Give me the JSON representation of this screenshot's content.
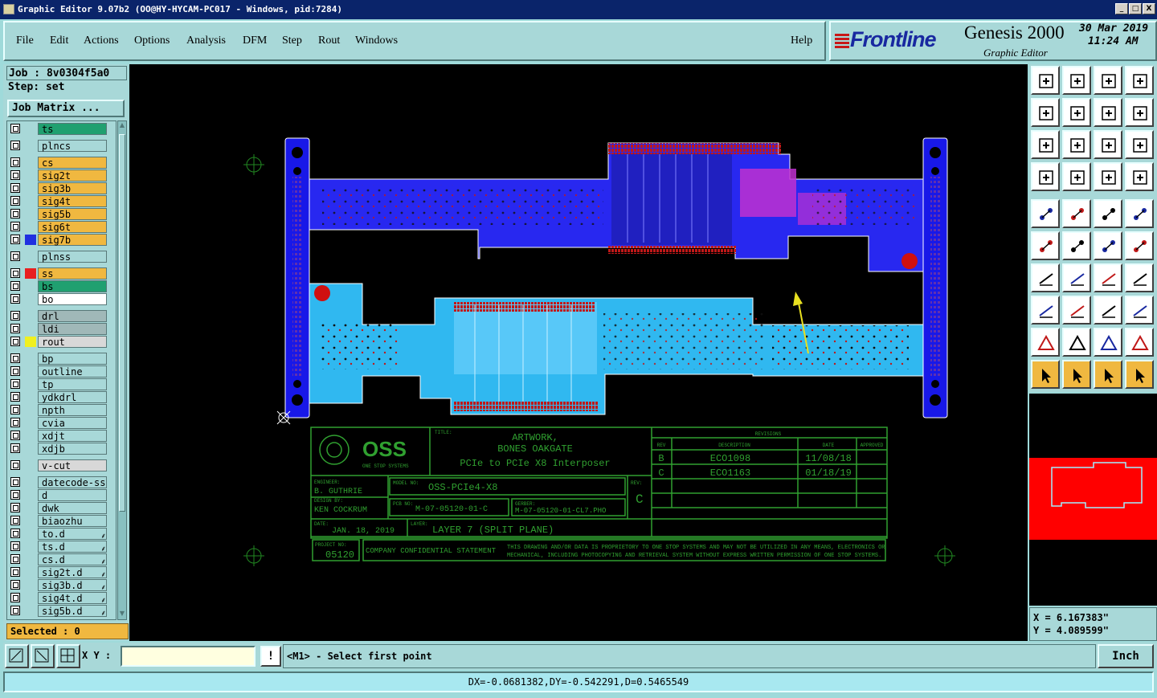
{
  "window": {
    "title": "Graphic Editor 9.07b2 (OO@HY-HYCAM-PC017 - Windows, pid:7284)",
    "min": "_",
    "max": "□",
    "close": "X"
  },
  "menu": [
    "File",
    "Edit",
    "Actions",
    "Options",
    "Analysis",
    "DFM",
    "Step",
    "Rout",
    "Windows"
  ],
  "help": "Help",
  "brand": {
    "logo": "Frontline",
    "product": "Genesis 2000",
    "subtitle": "Graphic Editor",
    "date": "30 Mar 2019",
    "time": "11:24 AM"
  },
  "job": {
    "job_label": "Job : 8v0304f5a0",
    "step_label": "Step: set",
    "matrix_button": "Job Matrix ..."
  },
  "layers": [
    {
      "name": "ts",
      "color": "#20a070",
      "swatch": "",
      "sep": false,
      "locked": false
    },
    {
      "name": "plncs",
      "color": "#a8d8d8",
      "swatch": "",
      "sep": true,
      "locked": false
    },
    {
      "name": "cs",
      "color": "#f0b840",
      "swatch": "",
      "sep": true,
      "locked": false
    },
    {
      "name": "sig2t",
      "color": "#f0b840",
      "swatch": "",
      "sep": false,
      "locked": false
    },
    {
      "name": "sig3b",
      "color": "#f0b840",
      "swatch": "",
      "sep": false,
      "locked": false
    },
    {
      "name": "sig4t",
      "color": "#f0b840",
      "swatch": "",
      "sep": false,
      "locked": false
    },
    {
      "name": "sig5b",
      "color": "#f0b840",
      "swatch": "",
      "sep": false,
      "locked": false
    },
    {
      "name": "sig6t",
      "color": "#f0b840",
      "swatch": "",
      "sep": false,
      "locked": false
    },
    {
      "name": "sig7b",
      "color": "#f0b840",
      "swatch": "#2030e0",
      "sep": false,
      "locked": false
    },
    {
      "name": "plnss",
      "color": "#a8d8d8",
      "swatch": "",
      "sep": true,
      "locked": false
    },
    {
      "name": "ss",
      "color": "#f0b840",
      "swatch": "#e82020",
      "sep": true,
      "locked": false
    },
    {
      "name": "bs",
      "color": "#20a070",
      "swatch": "",
      "sep": false,
      "locked": false
    },
    {
      "name": "bo",
      "color": "#ffffff",
      "swatch": "",
      "sep": false,
      "locked": false
    },
    {
      "name": "drl",
      "color": "#a0b8b8",
      "swatch": "",
      "sep": true,
      "locked": false
    },
    {
      "name": "ldi",
      "color": "#a0b8b8",
      "swatch": "",
      "sep": false,
      "locked": false
    },
    {
      "name": "rout",
      "color": "#d8d8d8",
      "swatch": "#f0f020",
      "sep": false,
      "locked": false
    },
    {
      "name": "bp",
      "color": "#a8d8d8",
      "swatch": "",
      "sep": true,
      "locked": false
    },
    {
      "name": "outline",
      "color": "#a8d8d8",
      "swatch": "",
      "sep": false,
      "locked": false
    },
    {
      "name": "tp",
      "color": "#a8d8d8",
      "swatch": "",
      "sep": false,
      "locked": false
    },
    {
      "name": "ydkdrl",
      "color": "#a8d8d8",
      "swatch": "",
      "sep": false,
      "locked": false
    },
    {
      "name": "npth",
      "color": "#a8d8d8",
      "swatch": "",
      "sep": false,
      "locked": false
    },
    {
      "name": "cvia",
      "color": "#a8d8d8",
      "swatch": "",
      "sep": false,
      "locked": false
    },
    {
      "name": "xdjt",
      "color": "#a8d8d8",
      "swatch": "",
      "sep": false,
      "locked": false
    },
    {
      "name": "xdjb",
      "color": "#a8d8d8",
      "swatch": "",
      "sep": false,
      "locked": false
    },
    {
      "name": "v-cut",
      "color": "#d8d8d8",
      "swatch": "",
      "sep": true,
      "locked": false
    },
    {
      "name": "datecode-ss",
      "color": "#a8d8d8",
      "swatch": "",
      "sep": true,
      "locked": false
    },
    {
      "name": "d",
      "color": "#a8d8d8",
      "swatch": "",
      "sep": false,
      "locked": false
    },
    {
      "name": "dwk",
      "color": "#a8d8d8",
      "swatch": "",
      "sep": false,
      "locked": false
    },
    {
      "name": "biaozhu",
      "color": "#a8d8d8",
      "swatch": "",
      "sep": false,
      "locked": false
    },
    {
      "name": "to.d",
      "color": "#a8d8d8",
      "swatch": "",
      "sep": false,
      "locked": true
    },
    {
      "name": "ts.d",
      "color": "#a8d8d8",
      "swatch": "",
      "sep": false,
      "locked": true
    },
    {
      "name": "cs.d",
      "color": "#a8d8d8",
      "swatch": "",
      "sep": false,
      "locked": true
    },
    {
      "name": "sig2t.d",
      "color": "#a8d8d8",
      "swatch": "",
      "sep": false,
      "locked": true
    },
    {
      "name": "sig3b.d",
      "color": "#a8d8d8",
      "swatch": "",
      "sep": false,
      "locked": true
    },
    {
      "name": "sig4t.d",
      "color": "#a8d8d8",
      "swatch": "",
      "sep": false,
      "locked": true
    },
    {
      "name": "sig5b.d",
      "color": "#a8d8d8",
      "swatch": "",
      "sep": false,
      "locked": true
    }
  ],
  "lock_glyph": "⸙",
  "selected": "Selected : 0",
  "title_block": {
    "company": "OSS",
    "company_sub": "ONE STOP SYSTEMS",
    "title_label": "TITLE:",
    "title_lines": [
      "ARTWORK,",
      "BONES OAKGATE",
      "PCIe to PCIe X8 Interposer"
    ],
    "revisions_label": "REVISIONS",
    "rev_headers": [
      "REV",
      "DESCRIPTION",
      "DATE",
      "APPROVED"
    ],
    "revs": [
      {
        "rev": "B",
        "desc": "ECO1098",
        "date": "11/08/18"
      },
      {
        "rev": "C",
        "desc": "ECO1163",
        "date": "01/18/19"
      }
    ],
    "engineer_label": "ENGINEER:",
    "engineer": "B. GUTHRIE",
    "design_label": "DESIGN BY:",
    "designer": "KEN COCKRUM",
    "model_label": "MODEL NO:",
    "model": "OSS-PCIe4-X8",
    "rev_label": "REV:",
    "rev": "C",
    "pcb_label": "PCB NO:",
    "pcb": "M-07-05120-01-C",
    "gerber_label": "GERBER:",
    "gerber": "M-07-05120-01-CL7.PHO",
    "date_label": "DATE:",
    "date": "JAN. 18, 2019",
    "layer_label": "LAYER:",
    "layer": "LAYER 7 (SPLIT PLANE)",
    "project_label": "PROJECT NO:",
    "project": "05120",
    "confidential": "COMPANY CONFIDENTIAL STATEMENT",
    "confidential_text_1": "THIS DRAWING AND/OR DATA IS PROPRIETORY TO ONE STOP SYSTEMS AND MAY NOT BE UTILIZED IN ANY MEANS, ELECTRONICS OR",
    "confidential_text_2": "MECHANICAL, INCLUDING PHOTOCOPYING AND RETRIEVAL SYSTEM WITHOUT EXPRESS WRITTEN PERMISSION OF ONE STOP SYSTEMS."
  },
  "coords": {
    "x": "X = 6.167383\"",
    "y": "Y = 4.089599\""
  },
  "xy_label": "X Y :",
  "xy_value": "",
  "bang": "!",
  "prompt": "<M1> - Select first point",
  "unit": "Inch",
  "status": "DX=-0.0681382,DY=-0.542291,D=0.5465549"
}
